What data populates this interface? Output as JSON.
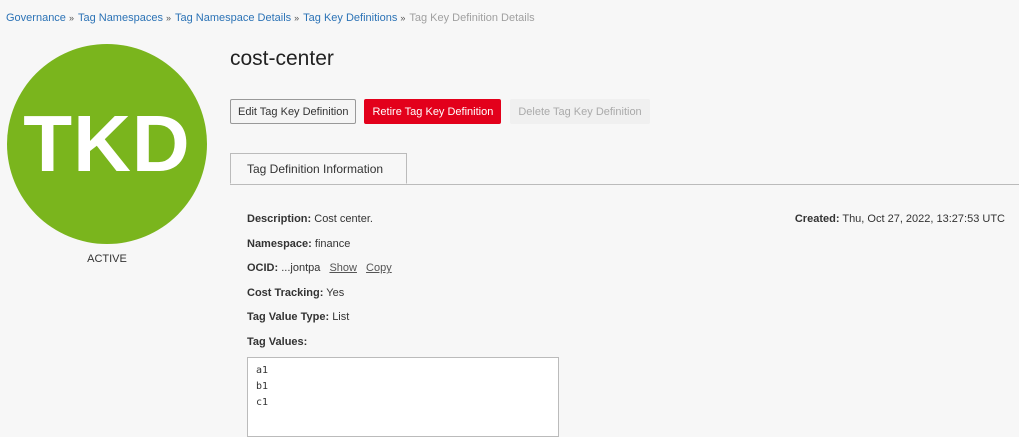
{
  "breadcrumb": [
    {
      "label": "Governance"
    },
    {
      "label": "Tag Namespaces"
    },
    {
      "label": "Tag Namespace Details"
    },
    {
      "label": "Tag Key Definitions"
    },
    {
      "label": "Tag Key Definition Details"
    }
  ],
  "avatar": {
    "initials": "TKD",
    "color": "#7ab51d"
  },
  "status": "ACTIVE",
  "title": "cost-center",
  "actions": {
    "edit": "Edit Tag Key Definition",
    "retire": "Retire Tag Key Definition",
    "delete": "Delete Tag Key Definition"
  },
  "tabs": [
    {
      "label": "Tag Definition Information"
    }
  ],
  "details": {
    "description": {
      "label": "Description:",
      "value": "Cost center."
    },
    "namespace": {
      "label": "Namespace:",
      "value": "finance"
    },
    "ocid": {
      "label": "OCID:",
      "value": "...jontpa",
      "show": "Show",
      "copy": "Copy"
    },
    "cost_tracking": {
      "label": "Cost Tracking:",
      "value": "Yes"
    },
    "tag_value_type": {
      "label": "Tag Value Type:",
      "value": "List"
    },
    "tag_values": {
      "label": "Tag Values:",
      "items": [
        "a1",
        "b1",
        "c1"
      ]
    },
    "created": {
      "label": "Created:",
      "value": "Thu, Oct 27, 2022, 13:27:53 UTC"
    }
  },
  "colors": {
    "link": "#2c73b6",
    "danger": "#e3001b",
    "accent": "#7ab51d"
  }
}
